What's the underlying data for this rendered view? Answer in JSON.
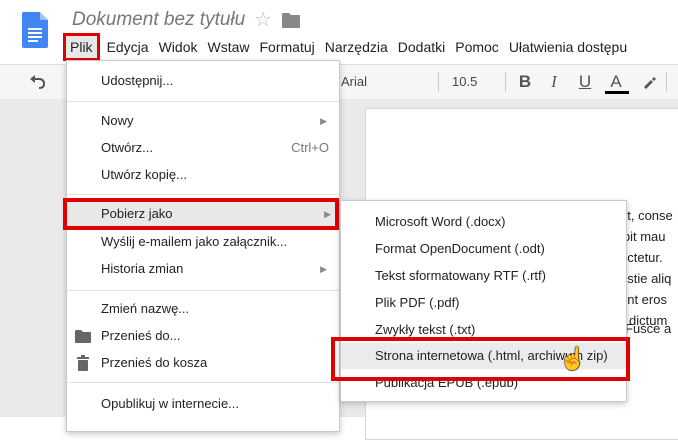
{
  "header": {
    "doc_title": "Dokument bez tytułu"
  },
  "menubar": {
    "items": [
      "Plik",
      "Edycja",
      "Widok",
      "Wstaw",
      "Formatuj",
      "Narzędzia",
      "Dodatki",
      "Pomoc",
      "Ułatwienia dostępu"
    ]
  },
  "toolbar": {
    "font": "Arial",
    "font_size": "10.5",
    "bold": "B",
    "italic": "I",
    "underline": "U",
    "text_color": "A"
  },
  "file_menu": {
    "share": "Udostępnij...",
    "new": "Nowy",
    "open": "Otwórz...",
    "open_shortcut": "Ctrl+O",
    "copy": "Utwórz kopię...",
    "download": "Pobierz jako",
    "email": "Wyślij e-mailem jako załącznik...",
    "history": "Historia zmian",
    "rename": "Zmień nazwę...",
    "move": "Przenieś do...",
    "trash": "Przenieś do kosza",
    "publish": "Opublikuj w internecie..."
  },
  "download_submenu": {
    "items": [
      "Microsoft Word (.docx)",
      "Format OpenDocument (.odt)",
      "Tekst sformatowany RTF (.rtf)",
      "Plik PDF (.pdf)",
      "Zwykły tekst (.txt)",
      "Strona internetowa (.html, archiwum zip)",
      "Publikacja EPUB (.epub)"
    ]
  },
  "document_text": [
    "et, conse",
    "ipit mau",
    "ectetur.",
    "estie aliq",
    "ent eros",
    "dictum",
    "Fusce a"
  ],
  "colors": {
    "highlight_red": "#e00000",
    "docs_blue": "#4285f4"
  }
}
